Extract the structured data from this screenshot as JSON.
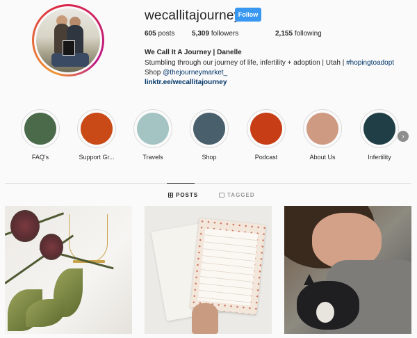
{
  "profile": {
    "username": "wecallitajourney",
    "follow_label": "Follow",
    "stats": {
      "posts_count": "605",
      "posts_label": "posts",
      "followers_count": "5,309",
      "followers_label": "followers",
      "following_count": "2,155",
      "following_label": "following"
    },
    "full_name": "We Call It A Journey | Danelle",
    "bio_line1_text": "Stumbling through our journey of life, infertility + adoption | Utah | ",
    "bio_line1_hashtag": "#hopingtoadopt",
    "bio_line2_text": "Shop ",
    "bio_line2_mention": "@thejourneymarket_",
    "link": "linktr.ee/wecallitajourney"
  },
  "highlights": [
    {
      "label": "FAQ's",
      "color": "#4a6a4a"
    },
    {
      "label": "Support Gr...",
      "color": "#c94a17"
    },
    {
      "label": "Travels",
      "color": "#a4c3c3"
    },
    {
      "label": "Shop",
      "color": "#495f6b"
    },
    {
      "label": "Podcast",
      "color": "#c73d16"
    },
    {
      "label": "About Us",
      "color": "#cf9a82"
    },
    {
      "label": "Infertility",
      "color": "#1f3e45"
    }
  ],
  "highlights_next_icon": "chevron-right-icon",
  "tabs": {
    "posts_label": "POSTS",
    "tagged_label": "TAGGED"
  },
  "posts": [
    {
      "name": "post-thistle-necklace"
    },
    {
      "name": "post-notepad-cards"
    },
    {
      "name": "post-woman-with-cat"
    }
  ]
}
